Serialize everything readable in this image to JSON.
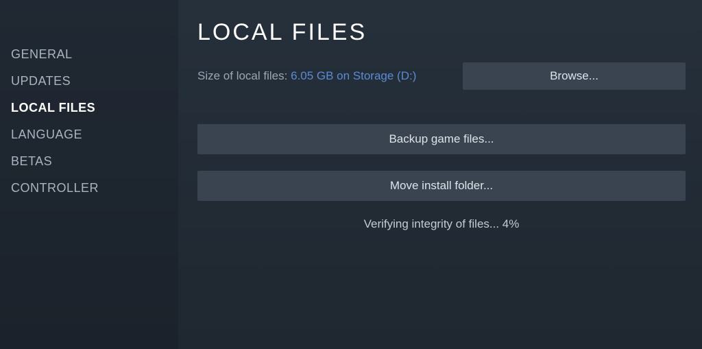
{
  "sidebar": {
    "items": [
      {
        "label": "GENERAL",
        "active": false
      },
      {
        "label": "UPDATES",
        "active": false
      },
      {
        "label": "LOCAL FILES",
        "active": true
      },
      {
        "label": "LANGUAGE",
        "active": false
      },
      {
        "label": "BETAS",
        "active": false
      },
      {
        "label": "CONTROLLER",
        "active": false
      }
    ]
  },
  "main": {
    "title": "LOCAL FILES",
    "size_label": "Size of local files: ",
    "size_value": "6.05 GB on Storage (D:)",
    "browse_label": "Browse...",
    "backup_label": "Backup game files...",
    "move_label": "Move install folder...",
    "status": "Verifying integrity of files... 4%"
  }
}
